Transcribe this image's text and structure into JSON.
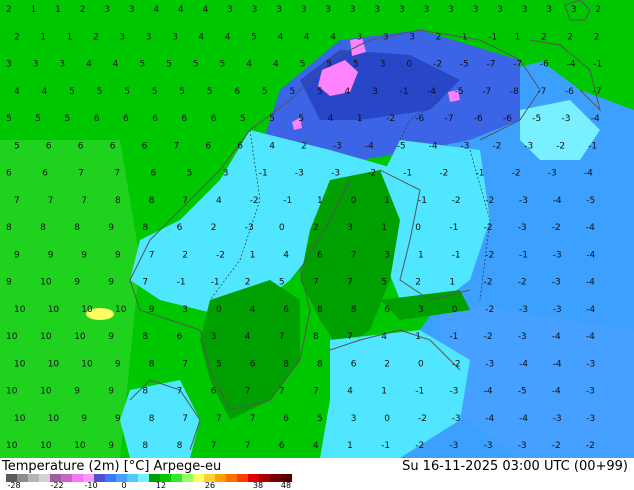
{
  "footer": {
    "title": "Temperature (2m) [°C] Arpege-eu",
    "timestamp": "Su 16-11-2025 03:00 UTC (00+99)"
  },
  "colorbar": {
    "ticks": [
      "-28",
      "-22",
      "-10",
      "0",
      "12",
      "26",
      "38",
      "48"
    ],
    "colors": [
      "#5a5a5a",
      "#8c8c8c",
      "#b4b4b4",
      "#d2d2d2",
      "#a05aa0",
      "#c864c8",
      "#f078f0",
      "#ff96ff",
      "#5050c8",
      "#3c78ff",
      "#46a0ff",
      "#50c8ff",
      "#78f0ff",
      "#00a000",
      "#00c800",
      "#32e632",
      "#96ff64",
      "#ffff64",
      "#ffd232",
      "#ffa000",
      "#ff6e00",
      "#ff3c00",
      "#dc0000",
      "#a00000",
      "#780000",
      "#500000"
    ]
  },
  "map_colors": {
    "sea_warm": "#00c800",
    "sea_mild": "#1ed21e",
    "land_green": "#00a000",
    "cold_light": "#50e6ff",
    "cold_mid": "#3ca0ff",
    "cold_deep": "#3c64e6",
    "cold_deeper": "#2846c8",
    "very_cold": "#ff82ff",
    "white_sea": "#78f0ff",
    "warm_spot": "#ffff64"
  },
  "values": {
    "row1": [
      "2",
      "1",
      "1",
      "2",
      "3",
      "3",
      "4",
      "4",
      "4",
      "3",
      "3",
      "3",
      "3",
      "3",
      "3",
      "3",
      "3",
      "3",
      "3",
      "3",
      "3",
      "3",
      "3",
      "3",
      "2"
    ],
    "row2": [
      "2",
      "1",
      "1",
      "2",
      "3",
      "3",
      "3",
      "4",
      "4",
      "5",
      "4",
      "4",
      "4",
      "3",
      "3",
      "3",
      "2",
      "1",
      "-1",
      "1",
      "2",
      "2",
      "2"
    ],
    "row3": [
      "3",
      "3",
      "3",
      "4",
      "4",
      "5",
      "5",
      "5",
      "5",
      "4",
      "4",
      "5",
      "5",
      "5",
      "3",
      "0",
      "-2",
      "-5",
      "-7",
      "-7",
      "-6",
      "-4",
      "-1"
    ],
    "row4": [
      "4",
      "4",
      "5",
      "5",
      "5",
      "5",
      "5",
      "5",
      "6",
      "5",
      "5",
      "5",
      "4",
      "3",
      "-1",
      "-4",
      "-5",
      "-7",
      "-8",
      "-7",
      "-6",
      "-7"
    ],
    "row5": [
      "5",
      "5",
      "5",
      "6",
      "6",
      "6",
      "6",
      "6",
      "5",
      "5",
      "5",
      "4",
      "1",
      "-2",
      "-6",
      "-7",
      "-6",
      "-6",
      "-5",
      "-3",
      "-4"
    ],
    "row6": [
      "5",
      "6",
      "6",
      "6",
      "6",
      "7",
      "6",
      "6",
      "4",
      "2",
      "-3",
      "-4",
      "-5",
      "-4",
      "-3",
      "-2",
      "-3",
      "-2",
      "-1"
    ],
    "row7": [
      "6",
      "6",
      "7",
      "7",
      "6",
      "5",
      "3",
      "-1",
      "-3",
      "-3",
      "-2",
      "-1",
      "-2",
      "-1",
      "-2",
      "-3",
      "-4"
    ],
    "row8": [
      "7",
      "7",
      "7",
      "8",
      "8",
      "7",
      "4",
      "-2",
      "-1",
      "1",
      "0",
      "1",
      "-1",
      "-2",
      "-2",
      "-3",
      "-4",
      "-5"
    ],
    "row9": [
      "8",
      "8",
      "8",
      "9",
      "8",
      "6",
      "2",
      "-3",
      "0",
      "2",
      "3",
      "1",
      "0",
      "-1",
      "-2",
      "-3",
      "-2",
      "-4"
    ],
    "row10": [
      "9",
      "9",
      "9",
      "9",
      "7",
      "2",
      "-2",
      "1",
      "4",
      "6",
      "7",
      "3",
      "1",
      "-1",
      "-2",
      "-1",
      "-3",
      "-4"
    ],
    "row11": [
      "9",
      "10",
      "9",
      "9",
      "7",
      "-1",
      "-1",
      "2",
      "5",
      "7",
      "7",
      "5",
      "2",
      "1",
      "-2",
      "-2",
      "-3",
      "-4"
    ],
    "row12": [
      "10",
      "10",
      "10",
      "10",
      "9",
      "3",
      "0",
      "4",
      "6",
      "8",
      "8",
      "6",
      "3",
      "0",
      "-2",
      "-3",
      "-3",
      "-4"
    ],
    "row13": [
      "10",
      "10",
      "10",
      "9",
      "8",
      "6",
      "3",
      "4",
      "7",
      "8",
      "7",
      "4",
      "1",
      "-1",
      "-2",
      "-3",
      "-4",
      "-4"
    ],
    "row14": [
      "10",
      "10",
      "10",
      "9",
      "8",
      "7",
      "5",
      "6",
      "8",
      "8",
      "6",
      "2",
      "0",
      "-2",
      "-3",
      "-4",
      "-4",
      "-3"
    ],
    "row15": [
      "10",
      "10",
      "9",
      "9",
      "8",
      "7",
      "6",
      "7",
      "7",
      "7",
      "4",
      "1",
      "-1",
      "-3",
      "-4",
      "-5",
      "-4",
      "-3"
    ],
    "row16": [
      "10",
      "10",
      "9",
      "9",
      "8",
      "7",
      "7",
      "7",
      "6",
      "5",
      "3",
      "0",
      "-2",
      "-3",
      "-4",
      "-4",
      "-3",
      "-3"
    ],
    "row17": [
      "10",
      "10",
      "10",
      "9",
      "8",
      "8",
      "7",
      "7",
      "6",
      "4",
      "1",
      "-1",
      "-2",
      "-3",
      "-3",
      "-3",
      "-2",
      "-2"
    ]
  }
}
